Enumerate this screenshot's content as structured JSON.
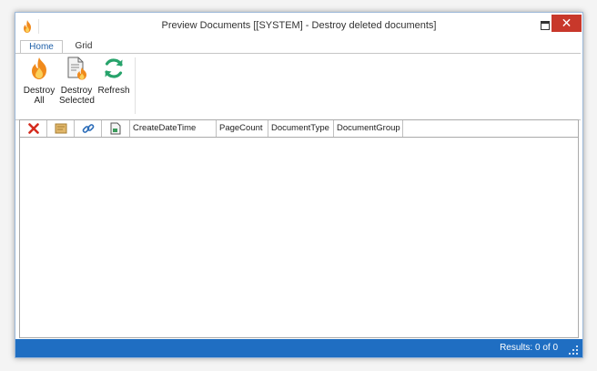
{
  "window": {
    "title": "Preview Documents [[SYSTEM] - Destroy deleted documents]",
    "maximize_icon": "maximize-icon",
    "close_glyph": "✕"
  },
  "tabs": [
    {
      "label": "Home",
      "active": true
    },
    {
      "label": "Grid",
      "active": false
    }
  ],
  "ribbon": {
    "buttons": [
      {
        "line1": "Destroy",
        "line2": "All",
        "icon": "flame-icon"
      },
      {
        "line1": "Destroy",
        "line2": "Selected",
        "icon": "document-flame-icon"
      },
      {
        "line1": "Refresh",
        "line2": "",
        "icon": "refresh-icon"
      }
    ]
  },
  "grid": {
    "icon_columns": [
      "delete-icon",
      "document-icon",
      "link-icon",
      "preview-icon"
    ],
    "columns": [
      "CreateDateTime",
      "PageCount",
      "DocumentType",
      "DocumentGroup"
    ]
  },
  "status": {
    "results": "Results: 0 of 0"
  },
  "colors": {
    "statusbar": "#1f6ec2",
    "close_button": "#c8382b",
    "active_tab_text": "#1e5fa8",
    "flame_orange": "#f08a1c",
    "refresh_green": "#27a36b",
    "delete_red": "#d42b1e"
  }
}
